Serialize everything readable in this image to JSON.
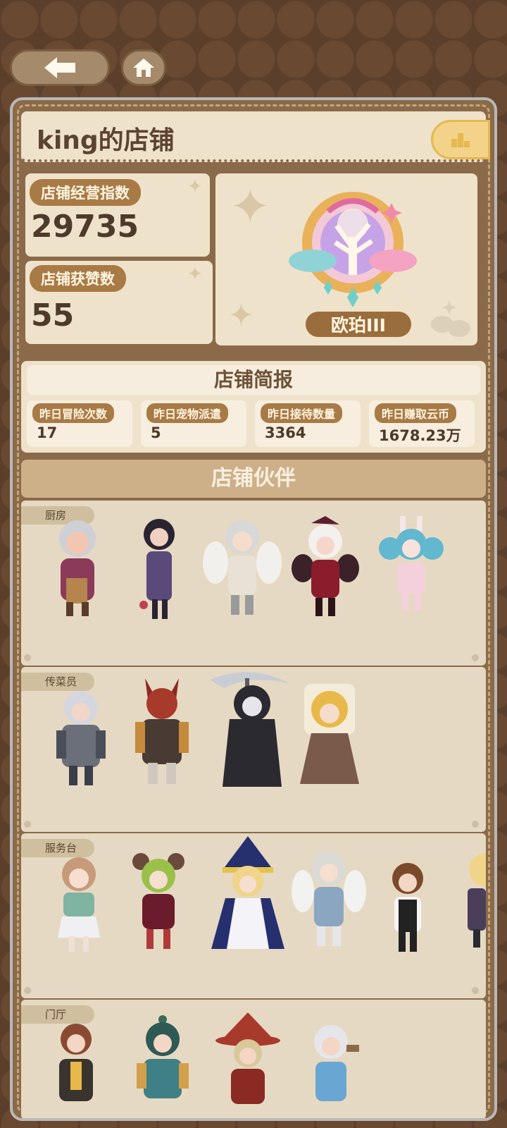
{
  "nav": {
    "back_icon": "arrow-left-icon",
    "home_icon": "home-icon"
  },
  "shop": {
    "title": "king的店铺",
    "rank_icon": "ranking-icon"
  },
  "stats": {
    "operating_index_label": "店铺经营指数",
    "operating_index_value": "29735",
    "likes_label": "店铺获赞数",
    "likes_value": "55"
  },
  "badge": {
    "name": "欧珀III",
    "icon": "tree-emblem-icon"
  },
  "report": {
    "title": "店铺简报",
    "items": [
      {
        "label": "昨日冒险次数",
        "value": "17"
      },
      {
        "label": "昨日宠物派遣",
        "value": "5"
      },
      {
        "label": "昨日接待数量",
        "value": "3364"
      },
      {
        "label": "昨日赚取云币",
        "value": "1678.23万"
      }
    ]
  },
  "partners": {
    "title": "店铺伙伴",
    "rows": [
      {
        "label": "厨房"
      },
      {
        "label": "传菜员"
      },
      {
        "label": "服务台"
      },
      {
        "label": "门厅"
      }
    ]
  },
  "colors": {
    "panel": "#efe2cb",
    "frame": "#8a6a48",
    "accent": "#a87a45",
    "gold": "#f3d389"
  }
}
